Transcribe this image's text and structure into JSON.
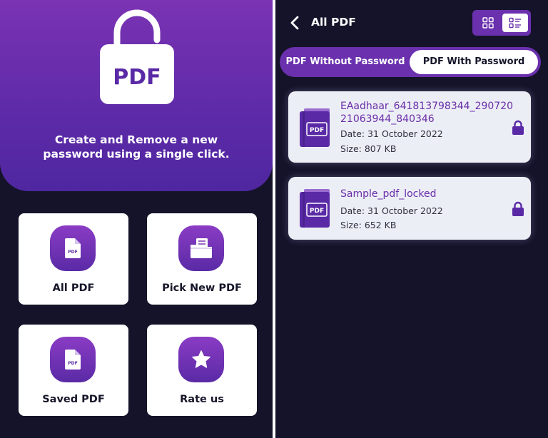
{
  "home": {
    "hero_logo_text": "PDF",
    "hero_line_1": "Create and Remove a new",
    "hero_line_2": "password using a single click.",
    "icon_pdf_text": "PDF",
    "cards": [
      {
        "label": "All PDF",
        "icon": "pdf-file-icon"
      },
      {
        "label": "Pick New PDF",
        "icon": "folder-files-icon"
      },
      {
        "label": "Saved PDF",
        "icon": "pdf-file-icon"
      },
      {
        "label": "Rate us",
        "icon": "star-icon"
      }
    ]
  },
  "all_pdf": {
    "title": "All PDF",
    "tabs": [
      {
        "label": "PDF Without Password",
        "active": false
      },
      {
        "label": "PDF With Password",
        "active": true
      }
    ],
    "active_view": "list",
    "file_icon_text": "PDF",
    "files": [
      {
        "name": "EAadhaar_641813798344_29072021063944_840346",
        "date": "Date: 31 October 2022",
        "size": "Size: 807 KB",
        "locked": true
      },
      {
        "name": "Sample_pdf_locked",
        "date": "Date: 31 October 2022",
        "size": "Size: 652 KB",
        "locked": true
      }
    ]
  },
  "colors": {
    "background_dark": "#15132a",
    "brand_purple": "#6a30ad",
    "brand_purple_light": "#8a3cc4",
    "file_name_purple": "#6a2ea8",
    "card_white": "#ffffff",
    "list_item_bg": "#eceef6"
  }
}
